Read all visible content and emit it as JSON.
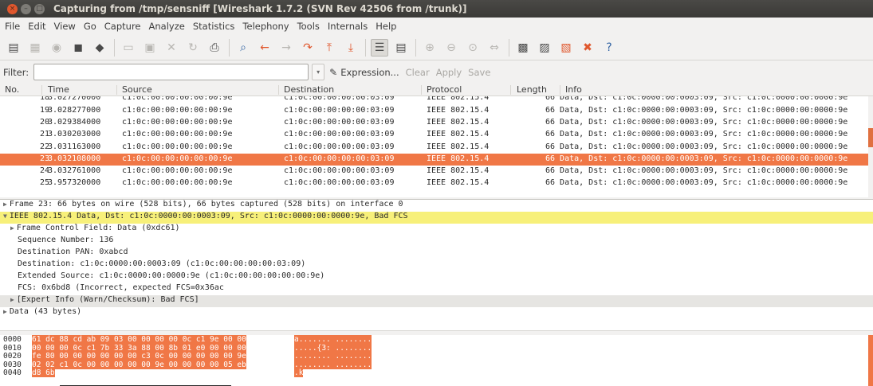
{
  "window": {
    "title": "Capturing from /tmp/sensniff   [Wireshark 1.7.2  (SVN Rev 42506 from /trunk)]",
    "close_glyph": "×",
    "min_glyph": "–",
    "max_glyph": "□"
  },
  "menu": [
    "File",
    "Edit",
    "View",
    "Go",
    "Capture",
    "Analyze",
    "Statistics",
    "Telephony",
    "Tools",
    "Internals",
    "Help"
  ],
  "toolbar_icons": [
    "interface-list-icon",
    "capture-options-icon",
    "start-capture-icon",
    "stop-capture-icon",
    "restart-capture-icon",
    "open-file-icon",
    "save-file-icon",
    "close-file-icon",
    "reload-icon",
    "print-icon",
    "find-packet-icon",
    "go-back-icon",
    "go-forward-icon",
    "go-to-packet-icon",
    "go-first-icon",
    "go-last-icon",
    "colorize-icon",
    "autoscroll-icon",
    "zoom-in-icon",
    "zoom-out-icon",
    "normal-size-icon",
    "resize-columns-icon",
    "capture-filters-icon",
    "display-filters-icon",
    "coloring-rules-icon",
    "preferences-icon",
    "help-icon"
  ],
  "filter": {
    "label": "Filter:",
    "value": "",
    "expression": "Expression...",
    "clear": "Clear",
    "apply": "Apply",
    "save": "Save",
    "dropdown_glyph": "▾"
  },
  "columns": [
    "No.",
    "Time",
    "Source",
    "Destination",
    "Protocol",
    "Length",
    "Info"
  ],
  "packets": [
    {
      "no": "18",
      "time": "3.027270000",
      "source": "c1:0c:00:00:00:00:00:9e",
      "destination": "c1:0c:00:00:00:00:03:09",
      "protocol": "IEEE 802.15.4",
      "length": "",
      "info": "66 Data, Dst: c1:0c:0000:00:0003:09, Src: c1:0c:0000:00:0000:9e"
    },
    {
      "no": "19",
      "time": "3.028277000",
      "source": "c1:0c:00:00:00:00:00:9e",
      "destination": "c1:0c:00:00:00:00:03:09",
      "protocol": "IEEE 802.15.4",
      "length": "",
      "info": "66 Data, Dst: c1:0c:0000:00:0003:09, Src: c1:0c:0000:00:0000:9e"
    },
    {
      "no": "20",
      "time": "3.029384000",
      "source": "c1:0c:00:00:00:00:00:9e",
      "destination": "c1:0c:00:00:00:00:03:09",
      "protocol": "IEEE 802.15.4",
      "length": "",
      "info": "66 Data, Dst: c1:0c:0000:00:0003:09, Src: c1:0c:0000:00:0000:9e"
    },
    {
      "no": "21",
      "time": "3.030203000",
      "source": "c1:0c:00:00:00:00:00:9e",
      "destination": "c1:0c:00:00:00:00:03:09",
      "protocol": "IEEE 802.15.4",
      "length": "",
      "info": "66 Data, Dst: c1:0c:0000:00:0003:09, Src: c1:0c:0000:00:0000:9e"
    },
    {
      "no": "22",
      "time": "3.031163000",
      "source": "c1:0c:00:00:00:00:00:9e",
      "destination": "c1:0c:00:00:00:00:03:09",
      "protocol": "IEEE 802.15.4",
      "length": "",
      "info": "66 Data, Dst: c1:0c:0000:00:0003:09, Src: c1:0c:0000:00:0000:9e"
    },
    {
      "no": "23",
      "time": "3.032108000",
      "source": "c1:0c:00:00:00:00:00:9e",
      "destination": "c1:0c:00:00:00:00:03:09",
      "protocol": "IEEE 802.15.4",
      "length": "",
      "info": "66 Data, Dst: c1:0c:0000:00:0003:09, Src: c1:0c:0000:00:0000:9e"
    },
    {
      "no": "24",
      "time": "3.032761000",
      "source": "c1:0c:00:00:00:00:00:9e",
      "destination": "c1:0c:00:00:00:00:03:09",
      "protocol": "IEEE 802.15.4",
      "length": "",
      "info": "66 Data, Dst: c1:0c:0000:00:0003:09, Src: c1:0c:0000:00:0000:9e"
    },
    {
      "no": "25",
      "time": "3.957320000",
      "source": "c1:0c:00:00:00:00:00:9e",
      "destination": "c1:0c:00:00:00:00:03:09",
      "protocol": "IEEE 802.15.4",
      "length": "",
      "info": "66 Data, Dst: c1:0c:0000:00:0003:09, Src: c1:0c:0000:00:0000:9e"
    }
  ],
  "selected_packet": "23",
  "details": [
    {
      "text": "Frame 23: 66 bytes on wire (528 bits), 66 bytes captured (528 bits) on interface 0",
      "expander": "▶",
      "style": "top"
    },
    {
      "text": "IEEE 802.15.4 Data, Dst: c1:0c:0000:00:0003:09, Src: c1:0c:0000:00:0000:9e, Bad FCS",
      "expander": "▼",
      "style": "hl"
    },
    {
      "text": "Frame Control Field: Data (0xdc61)",
      "expander": "▶",
      "style": "ind"
    },
    {
      "text": "Sequence Number: 136",
      "expander": "",
      "style": "ind2"
    },
    {
      "text": "Destination PAN: 0xabcd",
      "expander": "",
      "style": "ind2"
    },
    {
      "text": "Destination: c1:0c:0000:00:0003:09 (c1:0c:00:00:00:00:03:09)",
      "expander": "",
      "style": "ind2"
    },
    {
      "text": "Extended Source: c1:0c:0000:00:0000:9e (c1:0c:00:00:00:00:00:9e)",
      "expander": "",
      "style": "ind2"
    },
    {
      "text": "FCS: 0x6bd8 (Incorrect, expected FCS=0x36ac",
      "expander": "",
      "style": "ind2"
    },
    {
      "text": "[Expert Info (Warn/Checksum): Bad FCS]",
      "expander": "▶",
      "style": "ind gray"
    },
    {
      "text": "Data (43 bytes)",
      "expander": "▶",
      "style": "top"
    }
  ],
  "hex": [
    {
      "offset": "0000",
      "bytes": "61 dc 88 cd ab 09 03 00  00 00 00 0c c1 9e 00 00",
      "ascii": "a....... ........"
    },
    {
      "offset": "0010",
      "bytes": "00 00 00 0c c1 7b 33 3a  88 00 8b 01 e0 00 00 00",
      "ascii": ".....{3: ........"
    },
    {
      "offset": "0020",
      "bytes": "fe 80 00 00 00 00 00 00  c3 0c 00 00 00 00 00 9e",
      "ascii": "........ ........"
    },
    {
      "offset": "0030",
      "bytes": "02 02 c1 0c 00 00 00 00  00 9e 00 00 00 00 05 eb",
      "ascii": "........ ........"
    },
    {
      "offset": "0040",
      "bytes": "d8 6b",
      "ascii": ".k"
    }
  ],
  "colors": {
    "selection": "#f07746",
    "highlight": "#f7f07a",
    "titlebar": "#3c3b37"
  }
}
